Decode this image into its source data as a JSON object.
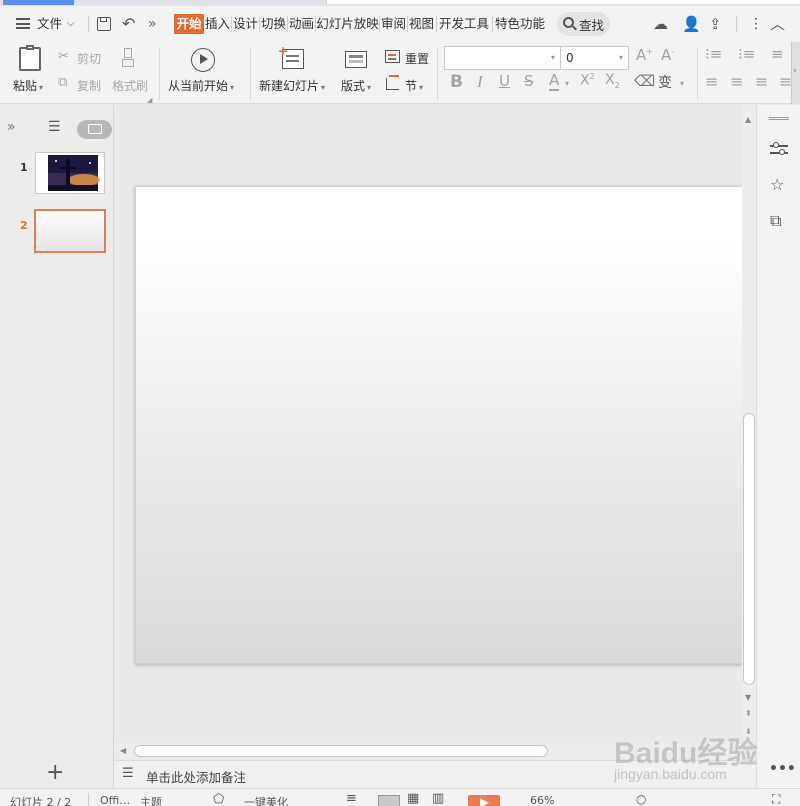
{
  "menubar": {
    "file_label": "文件",
    "tabs": [
      "开始",
      "插入",
      "设计",
      "切换",
      "动画",
      "幻灯片放映",
      "审阅",
      "视图",
      "开发工具",
      "特色功能"
    ],
    "search_label": "查找"
  },
  "ribbon": {
    "paste": "粘贴",
    "cut": "剪切",
    "copy": "复制",
    "format_painter": "格式刷",
    "from_current": "从当前开始",
    "new_slide": "新建幻灯片",
    "layout": "版式",
    "reset": "重置",
    "section": "节",
    "font_name": "",
    "font_size": "0"
  },
  "slides_panel": {
    "slides": [
      {
        "number": "1"
      },
      {
        "number": "2"
      }
    ]
  },
  "notes": {
    "placeholder": "单击此处添加备注"
  },
  "statusbar": {
    "slide_info": "幻灯片 2 / 2",
    "theme_prefix": "Offi…",
    "theme": "主题",
    "beautify": "一键美化",
    "zoom": "66%"
  },
  "watermark": {
    "brand": "Baidu经验",
    "url": "jingyan.baidu.com"
  }
}
